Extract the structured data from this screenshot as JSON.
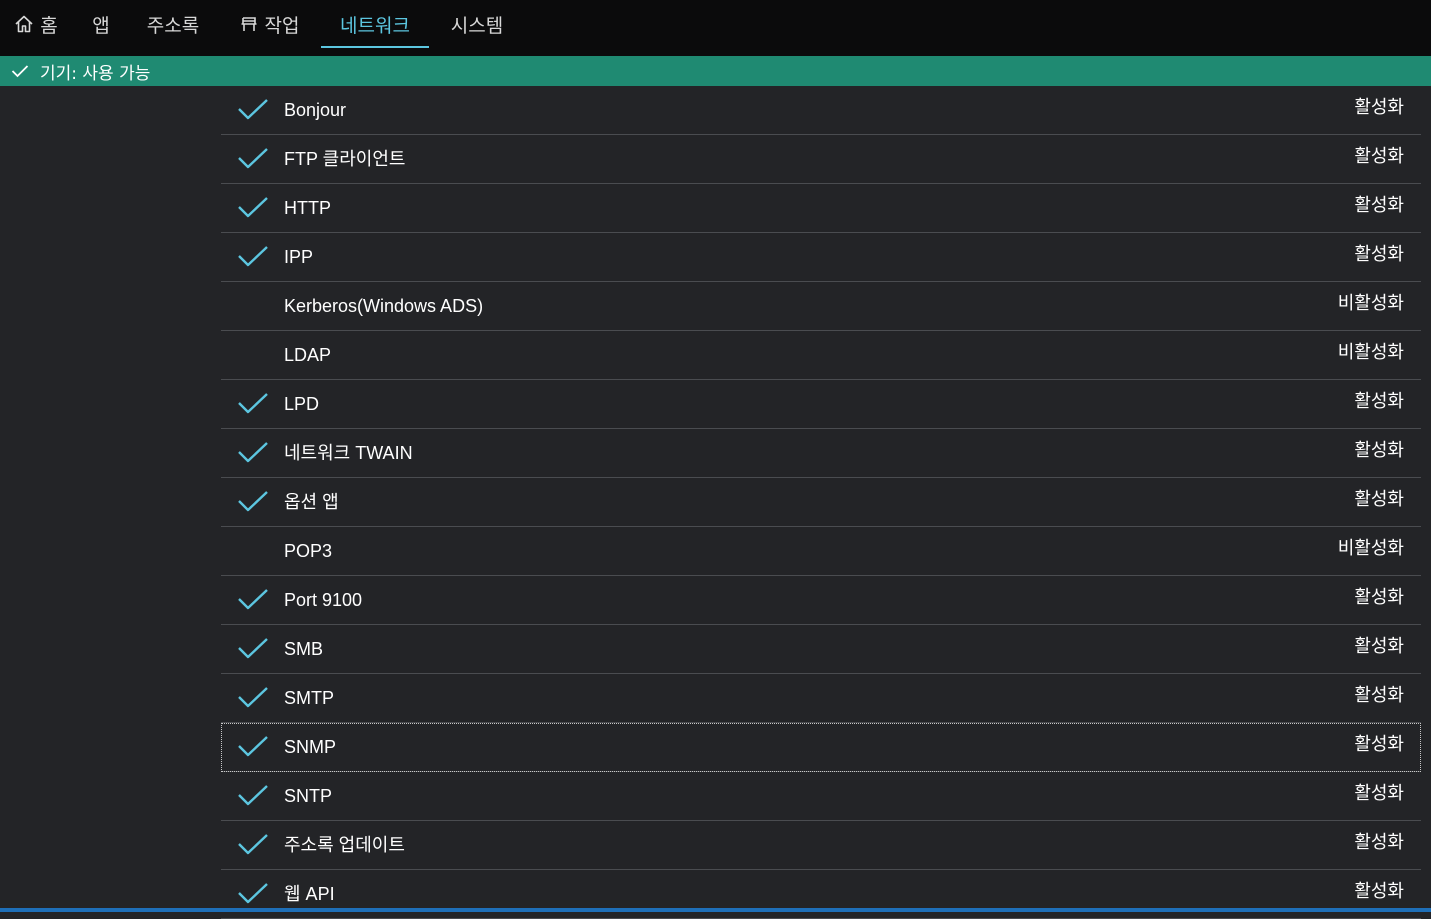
{
  "nav": {
    "tabs": [
      {
        "label": "홈",
        "icon": "home-icon"
      },
      {
        "label": "앱"
      },
      {
        "label": "주소록"
      },
      {
        "label": "작업",
        "icon": "job-icon"
      },
      {
        "label": "네트워크",
        "active": true
      },
      {
        "label": "시스템"
      }
    ]
  },
  "status": {
    "icon": "check-icon",
    "text": "기기: 사용 가능"
  },
  "services": [
    {
      "name": "Bonjour",
      "state": "활성화",
      "checked": true
    },
    {
      "name": "FTP 클라이언트",
      "state": "활성화",
      "checked": true
    },
    {
      "name": "HTTP",
      "state": "활성화",
      "checked": true
    },
    {
      "name": "IPP",
      "state": "활성화",
      "checked": true
    },
    {
      "name": "Kerberos(Windows ADS)",
      "state": "비활성화",
      "checked": false
    },
    {
      "name": "LDAP",
      "state": "비활성화",
      "checked": false
    },
    {
      "name": "LPD",
      "state": "활성화",
      "checked": true
    },
    {
      "name": "네트워크 TWAIN",
      "state": "활성화",
      "checked": true
    },
    {
      "name": "옵션 앱",
      "state": "활성화",
      "checked": true
    },
    {
      "name": "POP3",
      "state": "비활성화",
      "checked": false
    },
    {
      "name": "Port 9100",
      "state": "활성화",
      "checked": true
    },
    {
      "name": "SMB",
      "state": "활성화",
      "checked": true
    },
    {
      "name": "SMTP",
      "state": "활성화",
      "checked": true
    },
    {
      "name": "SNMP",
      "state": "활성화",
      "checked": true,
      "focused": true
    },
    {
      "name": "SNTP",
      "state": "활성화",
      "checked": true
    },
    {
      "name": "주소록 업데이트",
      "state": "활성화",
      "checked": true
    },
    {
      "name": "웹 API",
      "state": "활성화",
      "checked": true
    }
  ],
  "colors": {
    "accent": "#5cc6e0",
    "status_bar": "#1f8a72",
    "background": "#232427",
    "nav_background": "#0b0b0c",
    "divider": "#4a4c50"
  }
}
